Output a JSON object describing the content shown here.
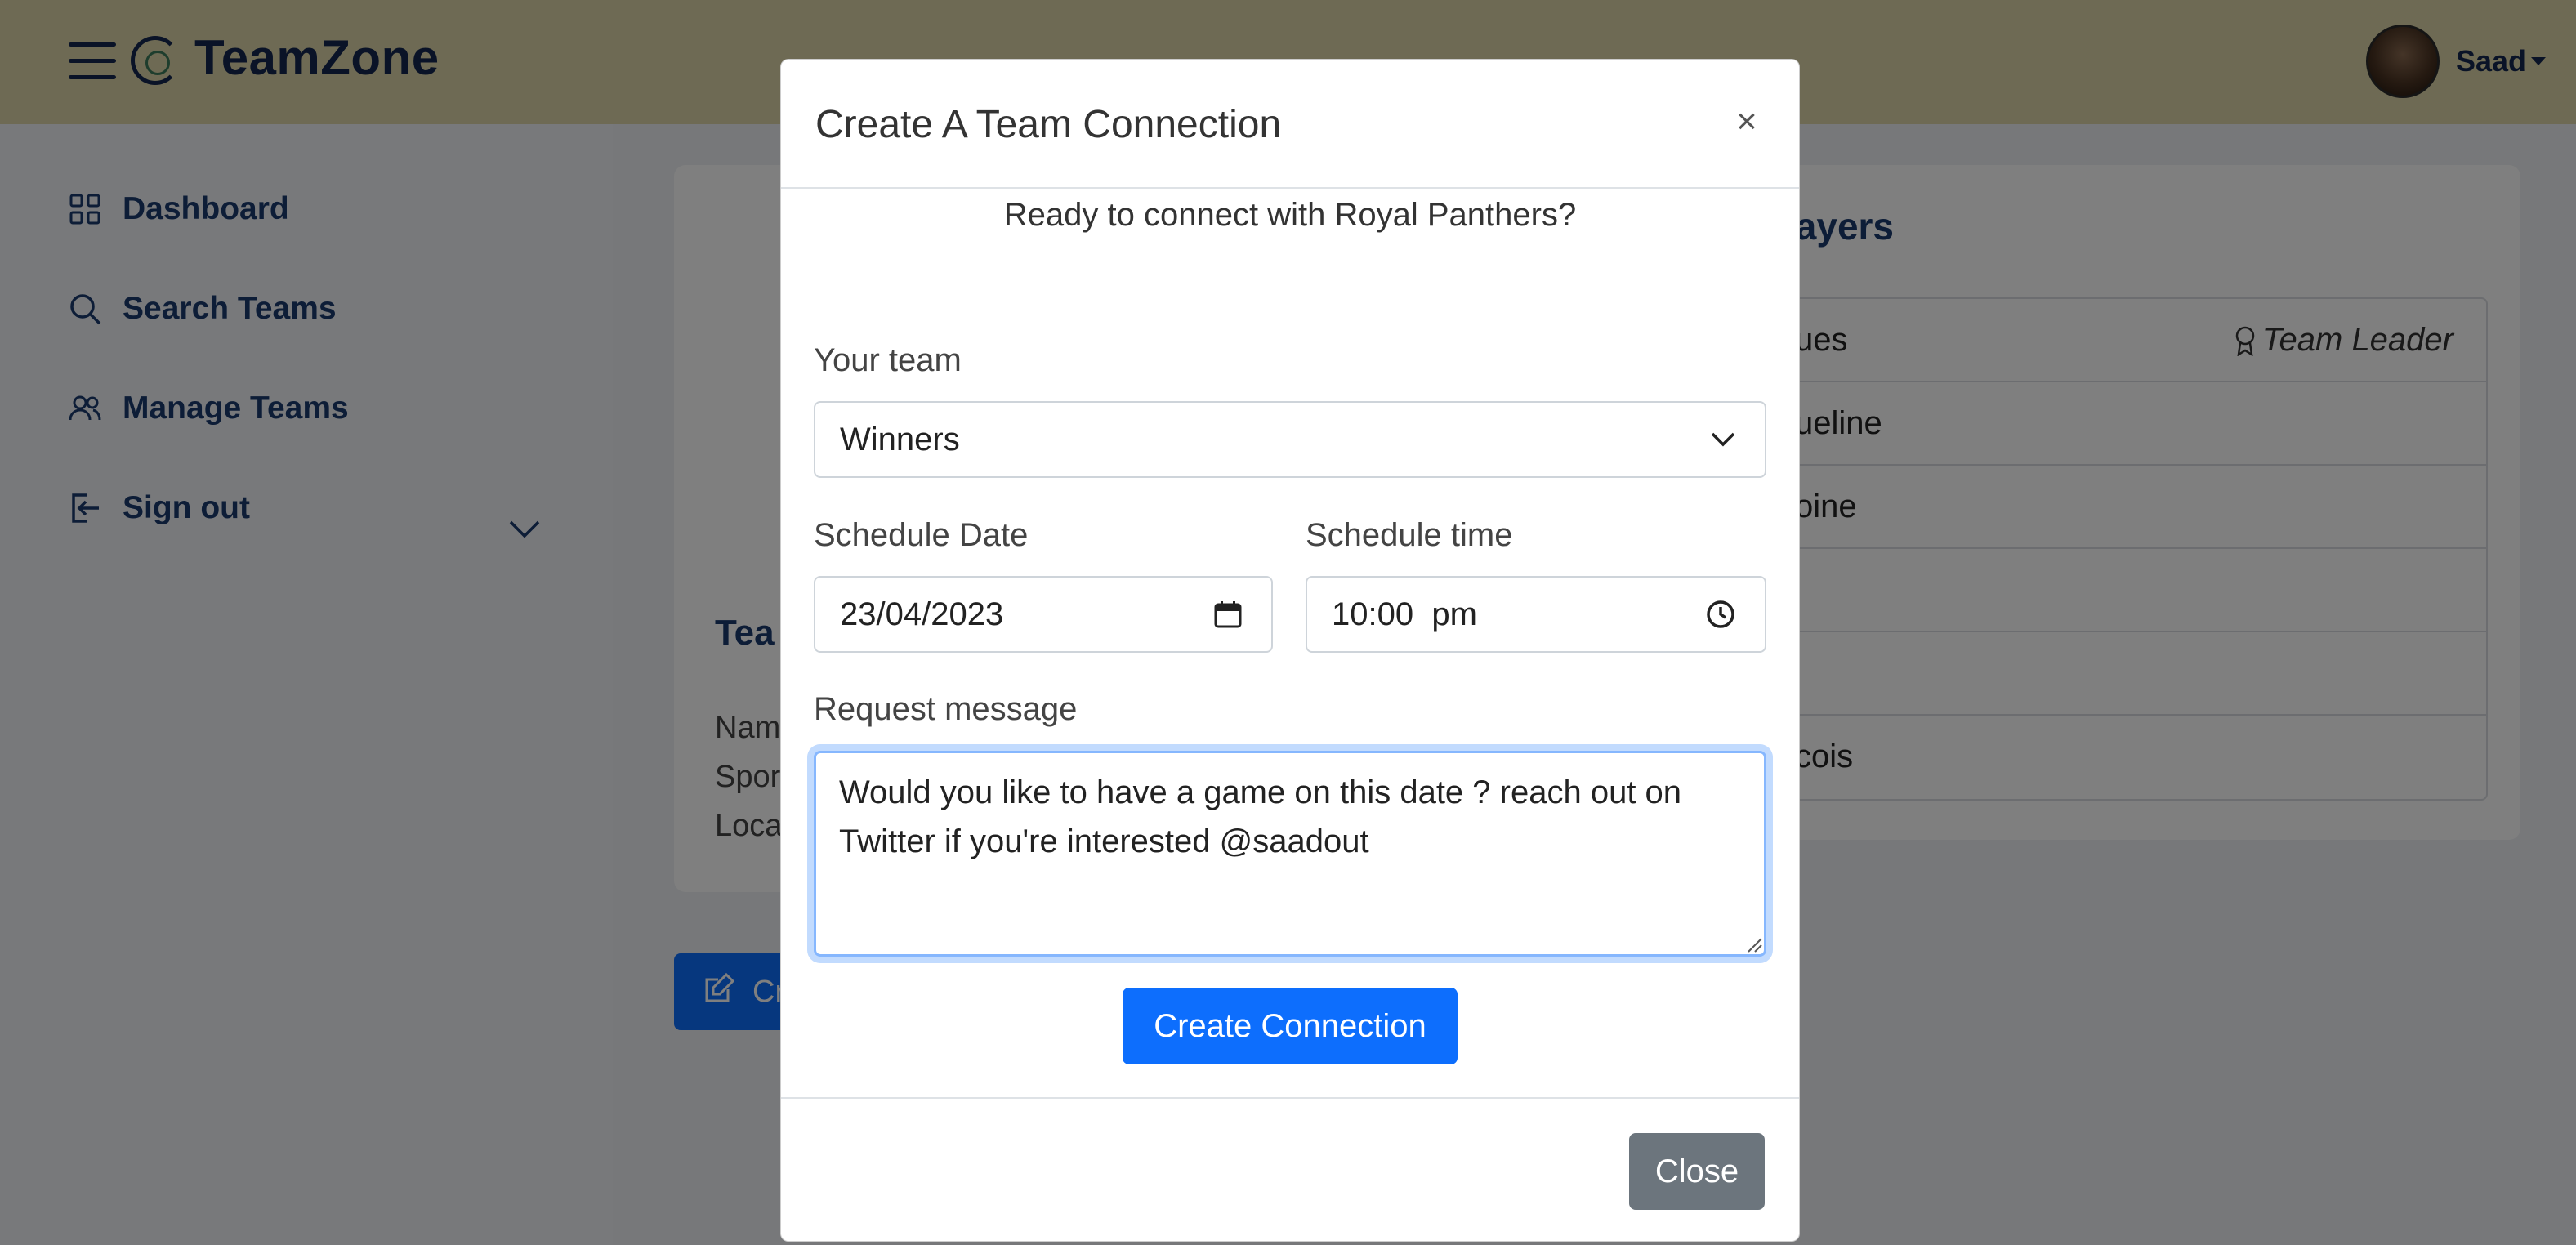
{
  "header": {
    "brand": "TeamZone",
    "user_name": "Saad"
  },
  "sidebar": {
    "items": [
      {
        "label": "Dashboard",
        "icon": "grid-icon"
      },
      {
        "label": "Search Teams",
        "icon": "search-icon"
      },
      {
        "label": "Manage Teams",
        "icon": "users-icon"
      },
      {
        "label": "Sign out",
        "icon": "sign-out-icon"
      }
    ]
  },
  "background": {
    "left_card": {
      "title_fragment": "Tea",
      "rows": [
        "Nam",
        "Spor",
        "Loca"
      ],
      "button_fragment": "Cr"
    },
    "players_card": {
      "heading_fragment": "layers",
      "leader_label": "Team Leader",
      "players": [
        "ues",
        "ueline",
        "oine",
        "",
        "",
        "cois"
      ]
    }
  },
  "modal": {
    "title": "Create A Team Connection",
    "close_symbol": "×",
    "prompt": "Ready to connect with Royal Panthers?",
    "team_label": "Your team",
    "team_value": "Winners",
    "date_label": "Schedule Date",
    "date_value": "23/04/2023",
    "time_label": "Schedule time",
    "time_value": "10:00  pm",
    "message_label": "Request message",
    "message_value": "Would you like to have a game on this date ? reach out on Twitter if you're interested @saadout",
    "submit_label": "Create Connection",
    "close_label": "Close"
  },
  "colors": {
    "topbar": "#dcd5a8",
    "brand_navy": "#14264f",
    "primary": "#0d6efd",
    "secondary": "#6c757d"
  }
}
